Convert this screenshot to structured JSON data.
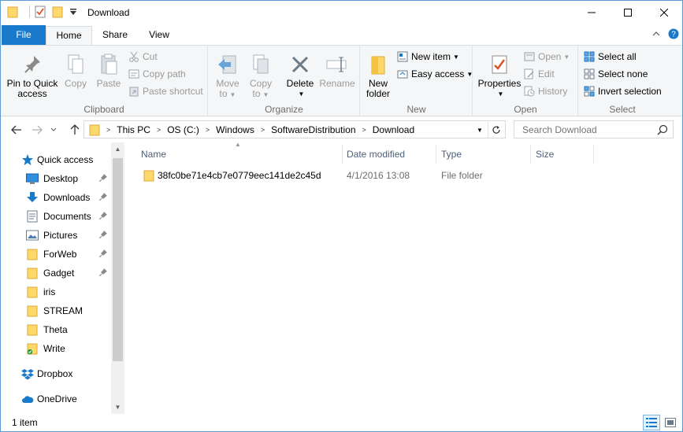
{
  "window": {
    "title": "Download"
  },
  "tabs": {
    "file": "File",
    "home": "Home",
    "share": "Share",
    "view": "View"
  },
  "ribbon": {
    "clipboard": {
      "label": "Clipboard",
      "pin": "Pin to Quick access",
      "pin_line1": "Pin to Quick",
      "pin_line2": "access",
      "copy": "Copy",
      "paste": "Paste",
      "cut": "Cut",
      "copy_path": "Copy path",
      "paste_shortcut": "Paste shortcut"
    },
    "organize": {
      "label": "Organize",
      "move_to_1": "Move",
      "move_to_2": "to",
      "copy_to_1": "Copy",
      "copy_to_2": "to",
      "delete": "Delete",
      "rename": "Rename"
    },
    "new": {
      "label": "New",
      "new_folder_1": "New",
      "new_folder_2": "folder",
      "new_item": "New item",
      "easy_access": "Easy access"
    },
    "open": {
      "label": "Open",
      "properties": "Properties",
      "open": "Open",
      "edit": "Edit",
      "history": "History"
    },
    "select": {
      "label": "Select",
      "select_all": "Select all",
      "select_none": "Select none",
      "invert_selection": "Invert selection"
    }
  },
  "address": {
    "crumbs": [
      "This PC",
      "OS (C:)",
      "Windows",
      "SoftwareDistribution",
      "Download"
    ],
    "search_placeholder": "Search Download"
  },
  "nav": {
    "quick_access": "Quick access",
    "items": [
      {
        "label": "Desktop",
        "icon": "desktop-icon",
        "pinned": true
      },
      {
        "label": "Downloads",
        "icon": "downloads-icon",
        "pinned": true
      },
      {
        "label": "Documents",
        "icon": "documents-icon",
        "pinned": true
      },
      {
        "label": "Pictures",
        "icon": "pictures-icon",
        "pinned": true
      },
      {
        "label": "ForWeb",
        "icon": "folder-icon",
        "pinned": true
      },
      {
        "label": "Gadget",
        "icon": "folder-icon",
        "pinned": true
      },
      {
        "label": "iris",
        "icon": "folder-icon",
        "pinned": false
      },
      {
        "label": "STREAM",
        "icon": "folder-icon",
        "pinned": false
      },
      {
        "label": "Theta",
        "icon": "folder-icon",
        "pinned": false
      },
      {
        "label": "Write",
        "icon": "folder-sync-icon",
        "pinned": false
      }
    ],
    "dropbox": "Dropbox",
    "onedrive": "OneDrive"
  },
  "columns": {
    "name": "Name",
    "date": "Date modified",
    "type": "Type",
    "size": "Size"
  },
  "files": [
    {
      "name": "38fc0be71e4cb7e0779eec141de2c45d",
      "date": "4/1/2016 13:08",
      "type": "File folder",
      "size": ""
    }
  ],
  "status": {
    "count": "1 item"
  },
  "colors": {
    "accent": "#1979ca",
    "folder": "#ffd86b",
    "ribbon_bg": "#f5f6f7"
  }
}
